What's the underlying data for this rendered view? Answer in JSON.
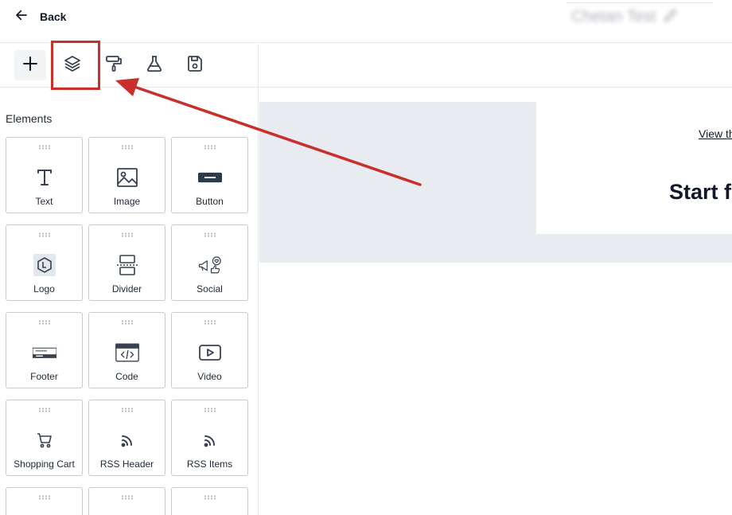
{
  "header": {
    "back_label": "Back",
    "document_title": "Chetan Test"
  },
  "toolbar": {
    "tools": [
      {
        "name": "add",
        "icon": "plus-icon"
      },
      {
        "name": "layers",
        "icon": "layers-icon",
        "highlighted": true
      },
      {
        "name": "style",
        "icon": "paint-roller-icon"
      },
      {
        "name": "test",
        "icon": "flask-icon"
      },
      {
        "name": "save",
        "icon": "save-icon"
      }
    ]
  },
  "sidebar": {
    "section_title": "Elements",
    "elements": [
      {
        "label": "Text",
        "icon": "text-icon"
      },
      {
        "label": "Image",
        "icon": "image-icon"
      },
      {
        "label": "Button",
        "icon": "button-icon"
      },
      {
        "label": "Logo",
        "icon": "logo-icon"
      },
      {
        "label": "Divider",
        "icon": "divider-icon"
      },
      {
        "label": "Social",
        "icon": "social-icon"
      },
      {
        "label": "Footer",
        "icon": "footer-icon"
      },
      {
        "label": "Code",
        "icon": "code-icon"
      },
      {
        "label": "Video",
        "icon": "video-icon"
      },
      {
        "label": "Shopping Cart",
        "icon": "shopping-cart-icon"
      },
      {
        "label": "RSS Header",
        "icon": "rss-icon"
      },
      {
        "label": "RSS Items",
        "icon": "rss-icon"
      }
    ]
  },
  "canvas": {
    "view_link": "View th",
    "heading": "Start fr"
  },
  "colors": {
    "annotation_red": "#c9302c",
    "canvas_background": "#e8ecf1",
    "icon_dark": "#374151"
  }
}
